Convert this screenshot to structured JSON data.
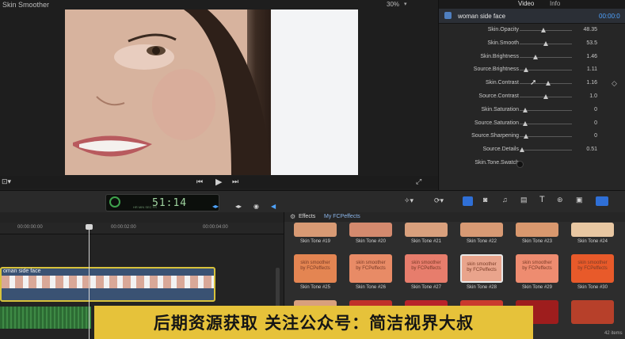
{
  "viewer": {
    "title": "Skin Smoother",
    "zoom": "30%"
  },
  "inspector": {
    "tabs": [
      "Video",
      "Info"
    ],
    "clip_name": "woman side face",
    "clip_timecode": "00:00:0",
    "params": [
      {
        "label": "Skin.Opacity",
        "value": "48.35",
        "pos": 0.45
      },
      {
        "label": "Skin.Smooth",
        "value": "53.5",
        "pos": 0.5
      },
      {
        "label": "Skin.Brightness",
        "value": "1.46",
        "pos": 0.3
      },
      {
        "label": "Source.Brightness",
        "value": "1.11",
        "pos": 0.12
      },
      {
        "label": "Skin.Contrast",
        "value": "1.16",
        "pos": 0.55
      },
      {
        "label": "Source.Contrast",
        "value": "1.0",
        "pos": 0.5
      },
      {
        "label": "Skin.Saturation",
        "value": "0",
        "pos": 0.1
      },
      {
        "label": "Source.Saturation",
        "value": "0",
        "pos": 0.1
      },
      {
        "label": "Source.Sharpening",
        "value": "0",
        "pos": 0.12
      },
      {
        "label": "Source.Details",
        "value": "0.51",
        "pos": 0.05
      },
      {
        "label": "Skin.Tone.Swatch",
        "value": "",
        "pos": null
      }
    ]
  },
  "toolbar": {
    "timecode": "51:14",
    "timecode_small": "HR  MIN  SEC  FR"
  },
  "timeline": {
    "ruler": [
      "00:00:00:00",
      "00:00:02:00",
      "00:00:04:00"
    ],
    "clip_label": "oman side face"
  },
  "effects": {
    "header_title": "Effects",
    "header_sub": "My FCPeffects",
    "tile_text": "skin smoother\nby FCPeffects",
    "row1": [
      "Skin Tone #19",
      "Skin Tone #20",
      "Skin Tone #21",
      "Skin Tone #22",
      "Skin Tone #23",
      "Skin Tone #24"
    ],
    "row2": [
      "Skin Tone #25",
      "Skin Tone #26",
      "Skin Tone #27",
      "Skin Tone #28",
      "Skin Tone #29",
      "Skin Tone #30"
    ],
    "count": "42 items"
  },
  "banner": {
    "text": "后期资源获取 关注公众号：简洁视界大叔"
  },
  "colors": {
    "accent": "#4fa3ff",
    "clip_border": "#d8c23b",
    "banner": "#e6c23a"
  }
}
